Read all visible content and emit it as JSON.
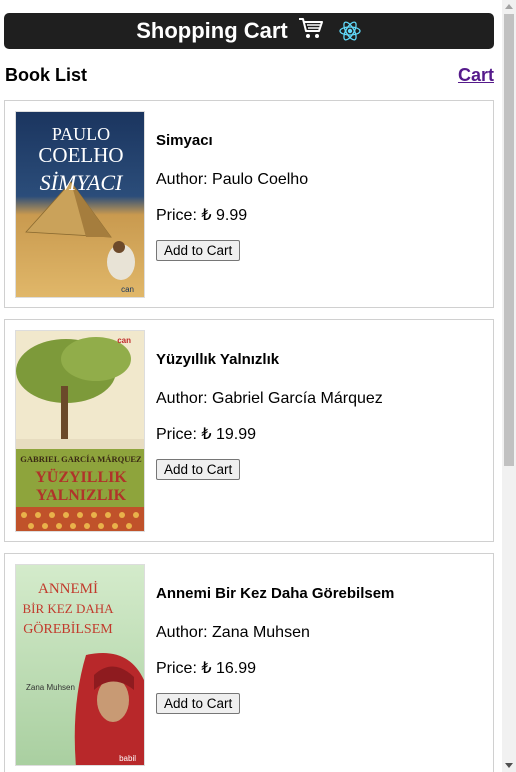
{
  "header": {
    "title": "Shopping Cart",
    "cart_icon": "cart-icon",
    "react_icon": "react-logo-icon",
    "react_color": "#61dafb"
  },
  "subbar": {
    "heading": "Book List",
    "cart_link": "Cart"
  },
  "books": [
    {
      "title": "Simyacı",
      "author": "Author: Paulo Coelho",
      "price": "Price: ₺ 9.99",
      "button": "Add to Cart",
      "cover": {
        "line1": "PAULO",
        "line2": "COELHO",
        "line3": "SİMYACI",
        "publisher": "can",
        "bg_top": "#1e3a6b",
        "bg_bottom": "#d9a44a"
      }
    },
    {
      "title": "Yüzyıllık Yalnızlık",
      "author": "Author: Gabriel García Márquez",
      "price": "Price: ₺ 19.99",
      "button": "Add to Cart",
      "cover": {
        "line1": "GABRIEL GARCÍA MÁRQUEZ",
        "line2": "YÜZYILLIK",
        "line3": "YALNIZLIK",
        "publisher": "can",
        "bg_top": "#f2e9cf",
        "bg_bottom": "#c05a2a"
      }
    },
    {
      "title": "Annemi Bir Kez Daha Görebilsem",
      "author": "Author: Zana Muhsen",
      "price": "Price: ₺ 16.99",
      "button": "Add to Cart",
      "cover": {
        "line1": "ANNEMİ",
        "line2": "BİR KEZ DAHA",
        "line3": "GÖREBİLSEM",
        "author": "Zana Muhsen",
        "publisher": "babil",
        "bg_top": "#cfe6c6",
        "bg_bottom": "#b8282a"
      }
    }
  ]
}
